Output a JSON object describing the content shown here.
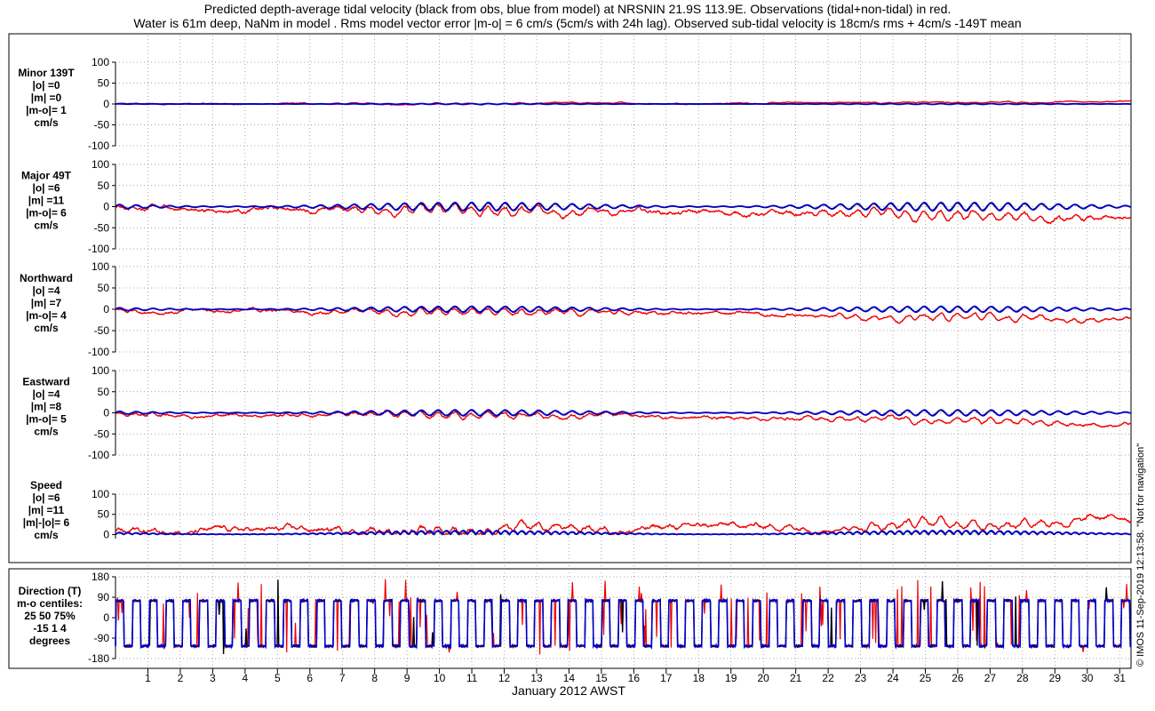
{
  "header": {
    "title_line1": "Predicted depth-average tidal velocity (black from obs, blue from model) at NRSNIN 21.9S 113.9E. Observations (tidal+non-tidal) in red.",
    "title_line2": "Water is 61m deep, NaNm in model . Rms model vector error |m-o| = 6 cm/s (5cm/s with 24h lag). Observed sub-tidal velocity is 18cm/s rms + 4cm/s -149T mean"
  },
  "side_note": "© IMOS 11-Sep-2019 12:13:58. \"Not for navigation\"",
  "colors": {
    "obs_tidal": "#000000",
    "model": "#0000cc",
    "observed": "#ee0000",
    "grid": "#888888"
  },
  "chart_data": {
    "type": "line",
    "xlabel": "January 2012 AWST",
    "x_ticks": [
      "1",
      "2",
      "3",
      "4",
      "5",
      "6",
      "7",
      "8",
      "9",
      "10",
      "11",
      "12",
      "13",
      "14",
      "15",
      "16",
      "17",
      "18",
      "19",
      "20",
      "21",
      "22",
      "23",
      "24",
      "25",
      "26",
      "27",
      "28",
      "29",
      "30",
      "31"
    ],
    "xlim_days": [
      0.0,
      31.35
    ],
    "series_legend": {
      "black": "predicted tidal velocity from obs",
      "blue": "predicted tidal velocity from model",
      "red": "Observations (tidal+non-tidal)"
    },
    "panels": [
      {
        "labels": [
          "Minor 139T",
          "|o| =0",
          "|m| =0",
          "|m-o|= 1",
          "cm/s"
        ],
        "ylim": [
          -100,
          100
        ],
        "y_ticks": [
          "100",
          "50",
          "0",
          "-50",
          "-100"
        ],
        "tidal_amp": 1,
        "red_mean_start": 0,
        "red_mean_end": 6,
        "red_noise": 2
      },
      {
        "labels": [
          "Major 49T",
          "|o| =6",
          "|m| =11",
          "|m-o|= 6",
          "cm/s"
        ],
        "ylim": [
          -100,
          100
        ],
        "y_ticks": [
          "100",
          "50",
          "0",
          "-50",
          "-100"
        ],
        "tidal_amp": 10,
        "red_mean_start": -5,
        "red_mean_end": -35,
        "red_noise": 8
      },
      {
        "labels": [
          "Northward",
          "|o| =4",
          "|m| =7",
          "|m-o|= 4",
          "cm/s"
        ],
        "ylim": [
          -100,
          100
        ],
        "y_ticks": [
          "100",
          "50",
          "0",
          "-50",
          "-100"
        ],
        "tidal_amp": 7,
        "red_mean_start": -3,
        "red_mean_end": -25,
        "red_noise": 6
      },
      {
        "labels": [
          "Eastward",
          "|o| =4",
          "|m| =8",
          "|m-o|= 5",
          "cm/s"
        ],
        "ylim": [
          -100,
          100
        ],
        "y_ticks": [
          "100",
          "50",
          "0",
          "-50",
          "-100"
        ],
        "tidal_amp": 7,
        "red_mean_start": -3,
        "red_mean_end": -25,
        "red_noise": 6
      },
      {
        "labels": [
          "Speed",
          "|o| =6",
          "|m| =11",
          "|m|-|o|= 6",
          "cm/s"
        ],
        "ylim": [
          -10,
          100
        ],
        "y_ticks": [
          "100",
          "50",
          "0"
        ],
        "tidal_amp": 10,
        "red_mean_start": 8,
        "red_mean_end": 40,
        "red_noise": 10
      },
      {
        "labels": [
          "Direction (T)",
          "m-o centiles:",
          "25  50  75%",
          "-15   1    4",
          "degrees"
        ],
        "ylim": [
          -180,
          180
        ],
        "y_ticks": [
          "180",
          "90",
          "0",
          "-90",
          "-180"
        ],
        "kind": "direction"
      }
    ]
  }
}
